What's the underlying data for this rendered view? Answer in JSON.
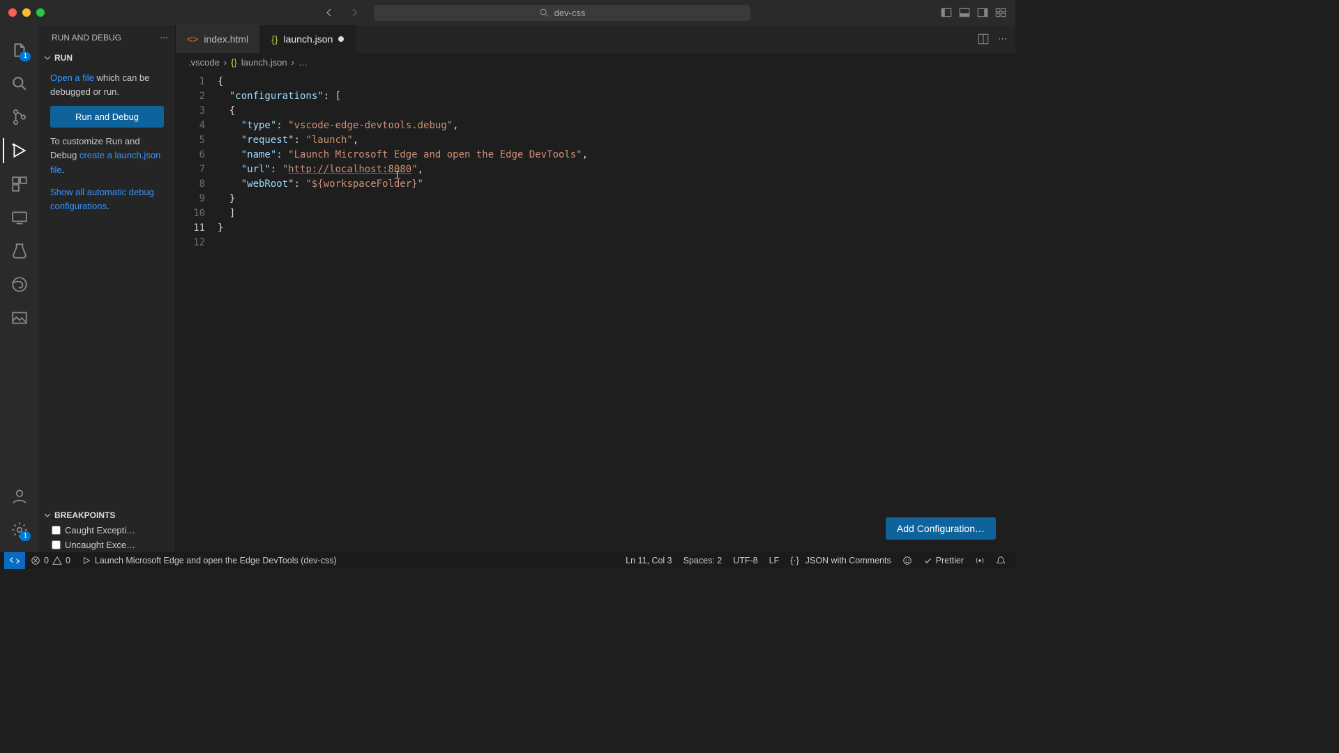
{
  "titlebar": {
    "project": "dev-css"
  },
  "activity": {
    "explorer_badge": "1",
    "settings_badge": "1"
  },
  "sidebar": {
    "title": "RUN AND DEBUG",
    "run_section": "RUN",
    "open_file_link": "Open a file",
    "open_file_rest": " which can be debugged or run.",
    "run_debug_btn": "Run and Debug",
    "customize_pre": "To customize Run and Debug ",
    "create_launch_link": "create a launch.json file",
    "customize_post": ".",
    "show_auto_link": "Show all automatic debug configurations",
    "show_auto_post": ".",
    "breakpoints_title": "BREAKPOINTS",
    "bp1": "Caught Excepti…",
    "bp2": "Uncaught Exce…"
  },
  "tabs": {
    "t1": "index.html",
    "t2": "launch.json"
  },
  "breadcrumb": {
    "p1": ".vscode",
    "p2": "launch.json",
    "p3": "…"
  },
  "editor": {
    "lines": [
      [
        {
          "t": "brace",
          "v": "{"
        }
      ],
      [
        {
          "t": "indent",
          "v": "  "
        },
        {
          "t": "key",
          "v": "\"configurations\""
        },
        {
          "t": "punc",
          "v": ": ["
        }
      ],
      [
        {
          "t": "indent",
          "v": "  "
        },
        {
          "t": "brace",
          "v": "{"
        }
      ],
      [
        {
          "t": "indent",
          "v": "    "
        },
        {
          "t": "key",
          "v": "\"type\""
        },
        {
          "t": "punc",
          "v": ": "
        },
        {
          "t": "string",
          "v": "\"vscode-edge-devtools.debug\""
        },
        {
          "t": "punc",
          "v": ","
        }
      ],
      [
        {
          "t": "indent",
          "v": "    "
        },
        {
          "t": "key",
          "v": "\"request\""
        },
        {
          "t": "punc",
          "v": ": "
        },
        {
          "t": "string",
          "v": "\"launch\""
        },
        {
          "t": "punc",
          "v": ","
        }
      ],
      [
        {
          "t": "indent",
          "v": "    "
        },
        {
          "t": "key",
          "v": "\"name\""
        },
        {
          "t": "punc",
          "v": ": "
        },
        {
          "t": "string",
          "v": "\"Launch Microsoft Edge and open the Edge DevTools\""
        },
        {
          "t": "punc",
          "v": ","
        }
      ],
      [
        {
          "t": "indent",
          "v": "    "
        },
        {
          "t": "key",
          "v": "\"url\""
        },
        {
          "t": "punc",
          "v": ": "
        },
        {
          "t": "string",
          "v": "\""
        },
        {
          "t": "link",
          "v": "http://localhost:8080"
        },
        {
          "t": "string",
          "v": "\""
        },
        {
          "t": "punc",
          "v": ","
        }
      ],
      [
        {
          "t": "indent",
          "v": "    "
        },
        {
          "t": "key",
          "v": "\"webRoot\""
        },
        {
          "t": "punc",
          "v": ": "
        },
        {
          "t": "string",
          "v": "\"${workspaceFolder}\""
        }
      ],
      [
        {
          "t": "indent",
          "v": "  "
        },
        {
          "t": "brace",
          "v": "}"
        }
      ],
      [
        {
          "t": "indent",
          "v": "  "
        },
        {
          "t": "punc",
          "v": "]"
        }
      ],
      [
        {
          "t": "indent",
          "v": ""
        }
      ],
      [
        {
          "t": "brace",
          "v": "}"
        }
      ]
    ],
    "current_line": 11,
    "add_config_btn": "Add Configuration…"
  },
  "statusbar": {
    "errors": "0",
    "warnings": "0",
    "launch_label": "Launch Microsoft Edge and open the Edge DevTools (dev-css)",
    "ln_col": "Ln 11, Col 3",
    "spaces": "Spaces: 2",
    "encoding": "UTF-8",
    "eol": "LF",
    "language": "JSON with Comments",
    "prettier": "Prettier"
  }
}
